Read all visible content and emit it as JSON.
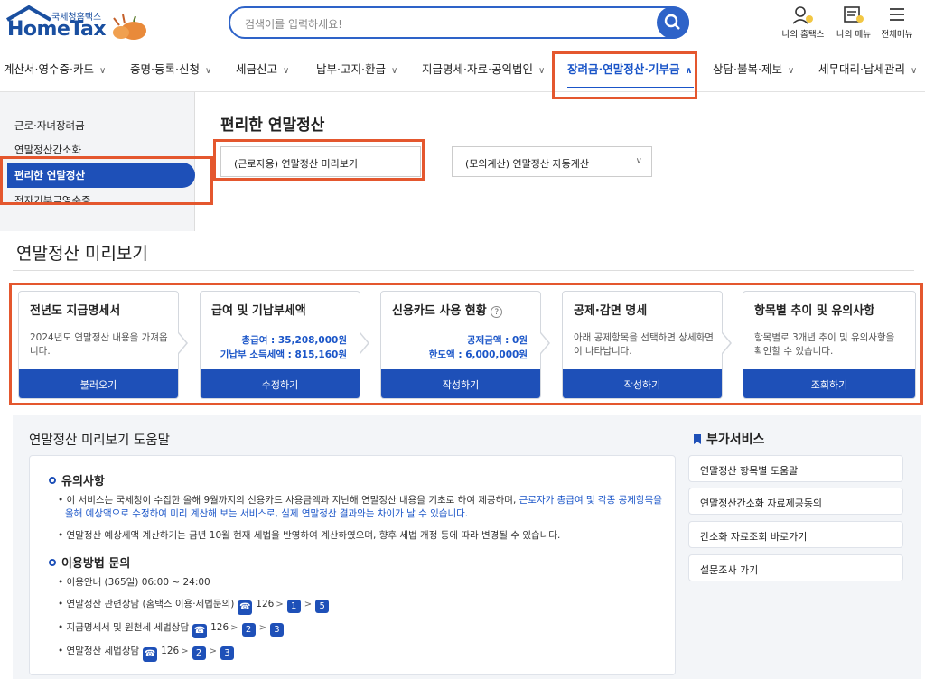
{
  "header": {
    "logo_top": "국세청홈택스",
    "logo_main": "HomeTax",
    "search_placeholder": "검색어를 입력하세요!",
    "utils": [
      "나의 홈택스",
      "나의 메뉴",
      "전체메뉴"
    ]
  },
  "gnb": [
    "계산서·영수증·카드",
    "증명·등록·신청",
    "세금신고",
    "납부·고지·환급",
    "지급명세·자료·공익법인",
    "장려금·연말정산·기부금",
    "상담·불복·제보",
    "세무대리·납세관리"
  ],
  "sidebar": {
    "items": [
      "근로·자녀장려금",
      "연말정산간소화",
      "편리한 연말정산",
      "전자기부금영수증"
    ]
  },
  "content": {
    "page_title": "편리한 연말정산",
    "seg1": "(근로자용) 연말정산 미리보기",
    "seg2": "(모의계산) 연말정산 자동계산",
    "section_title": "연말정산 미리보기"
  },
  "cards": [
    {
      "title": "전년도 지급명세서",
      "desc": "2024년도 연말정산 내용을 가져옵니다.",
      "button": "불러오기"
    },
    {
      "title": "급여 및 기납부세액",
      "val1": "총급여 : 35,208,000원",
      "val2": "기납부 소득세액 : 815,160원",
      "button": "수정하기"
    },
    {
      "title": "신용카드 사용 현황",
      "val1": "공제금액 : 0원",
      "val2": "한도액 : 6,000,000원",
      "button": "작성하기"
    },
    {
      "title": "공제·감면 명세",
      "desc": "아래 공제항목을 선택하면 상세화면이 나타납니다.",
      "button": "작성하기"
    },
    {
      "title": "항목별 추이 및 유의사항",
      "desc": "항목별로 3개년 추이 및 유의사항을 확인할 수 있습니다.",
      "button": "조회하기"
    }
  ],
  "help": {
    "title": "연말정산 미리보기 도움말",
    "notes_heading": "유의사항",
    "note1_a": "이 서비스는 국세청이 수집한 올해 9월까지의 신용카드 사용금액과 지난해 연말정산 내용을 기초로 하여 제공하며,",
    "note1_b": "근로자가 총급여 및 각종 공제항목을",
    "note1_c": "올해 예상액으로 수정하여 미리 계산해 보는 서비스로, 실제 연말정산 결과와는 차이가 날 수 있습니다.",
    "note2": "연말정산 예상세액 계산하기는 금년 10월 현재 세법을 반영하여 계산하였으며, 향후 세법 개정 등에 따라 변경될 수 있습니다.",
    "inquiry_heading": "이용방법 문의",
    "hours": "이용안내 (365일) 06:00 ~ 24:00",
    "line1": "연말정산 관련상담 (홈택스 이용·세법문의)",
    "line1_nums": [
      "126",
      "1",
      "5"
    ],
    "line2": "지급명세서 및 원천세 세법상담",
    "line2_nums": [
      "126",
      "2",
      "3"
    ],
    "line3": "연말정산 세법상담",
    "line3_nums": [
      "126",
      "2",
      "3"
    ]
  },
  "services": {
    "title": "부가서비스",
    "items": [
      "연말정산 항목별 도움말",
      "연말정산간소화 자료제공동의",
      "간소화 자료조회 바로가기",
      "설문조사 가기"
    ]
  },
  "colors": {
    "accent": "#1e50b8",
    "highlight": "#e4572e"
  }
}
